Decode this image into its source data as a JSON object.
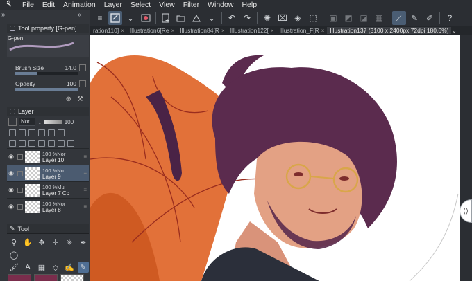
{
  "menu": {
    "items": [
      "File",
      "Edit",
      "Animation",
      "Layer",
      "Select",
      "View",
      "Filter",
      "Window",
      "Help"
    ]
  },
  "tool_property": {
    "header": "Tool property [G-pen]",
    "preset": "G-pen",
    "brush_size_label": "Brush Size",
    "brush_size_value": "14.0",
    "brush_size_level": 0.35,
    "opacity_label": "Opacity",
    "opacity_value": "100",
    "opacity_level": 1.0
  },
  "layer_panel": {
    "header": "Layer",
    "blend_mode": "Nor",
    "opacity": "100",
    "layers": [
      {
        "pct": "100 %Nor",
        "name": "Layer 10",
        "visible": true,
        "selected": false
      },
      {
        "pct": "100 %No",
        "name": "Layer 9",
        "visible": true,
        "selected": true
      },
      {
        "pct": "100 %Mu",
        "name": "Layer 7 Co",
        "visible": true,
        "selected": false
      },
      {
        "pct": "100 %Nor",
        "name": "Layer 8",
        "visible": true,
        "selected": false
      }
    ]
  },
  "tool_panel": {
    "header": "Tool"
  },
  "tabs": [
    {
      "label": "ration110]",
      "active": false
    },
    {
      "label": "Illustration6[Re",
      "active": false
    },
    {
      "label": "Illustration84[R",
      "active": false
    },
    {
      "label": "Illustration122[",
      "active": false
    },
    {
      "label": "Illustration_F[R",
      "active": false
    },
    {
      "label": "Illustration137 (3100 x 2400px 72dpi 180.6%)",
      "active": true
    }
  ],
  "colors": {
    "main_color": "#7a2d4c",
    "sub_color": "#7a2d4c",
    "accent": "#4b5b70",
    "hair": "#5b2b4e",
    "coat": "#e0692e",
    "skin": "#e3a184"
  }
}
